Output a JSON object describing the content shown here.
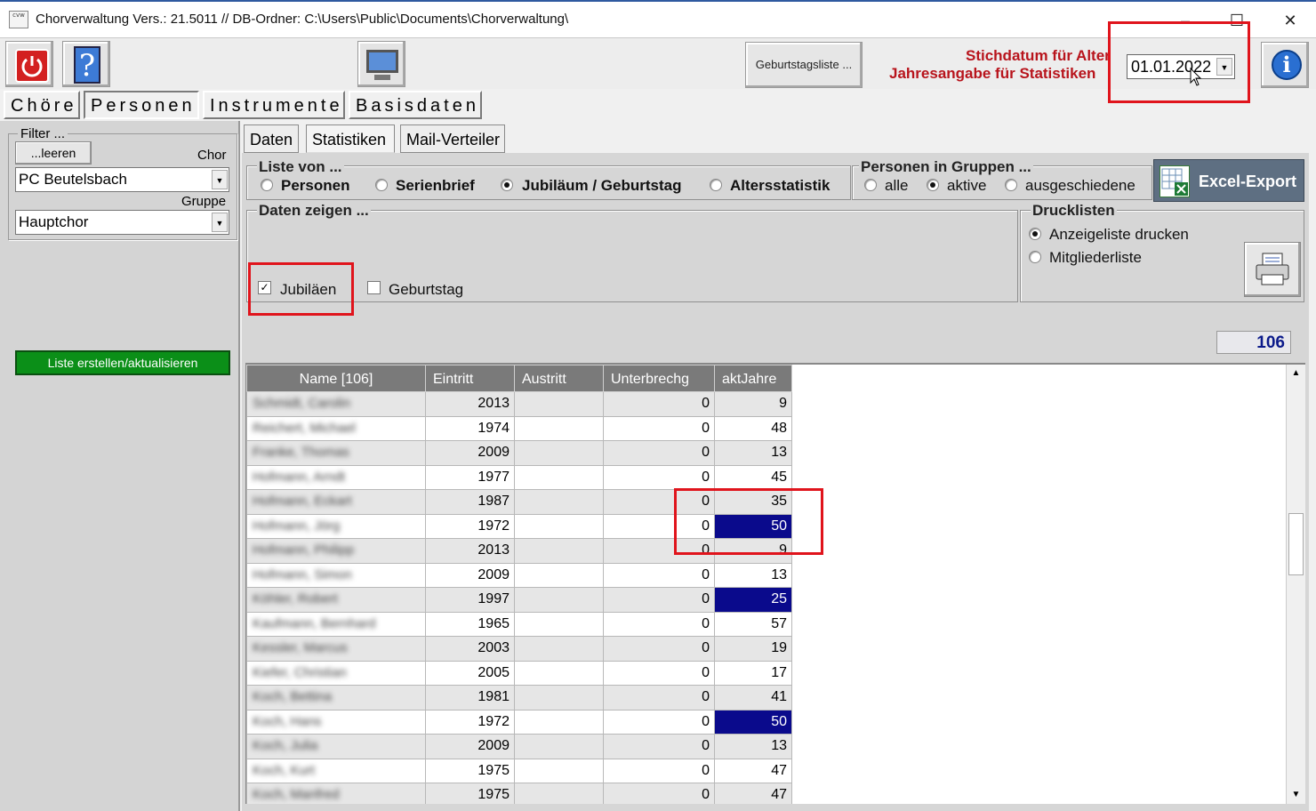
{
  "window": {
    "title": "Chorverwaltung Vers.: 21.5011 // DB-Ordner: C:\\Users\\Public\\Documents\\Chorverwaltung\\",
    "app_icon_text": "cvw",
    "minimize": "‒",
    "maximize": "☐",
    "close": "✕"
  },
  "toolbar": {
    "birthday_list_label": "Geburtstagsliste ...",
    "reference_label_1": "Stichdatum für Alter",
    "reference_label_2": "Jahresangabe für Statistiken",
    "reference_date": "01.01.2022",
    "help_glyph": "?",
    "info_glyph": "i"
  },
  "main_tabs": [
    {
      "label": "Chöre",
      "active": false
    },
    {
      "label": "Personen",
      "active": true
    },
    {
      "label": "Instrumente",
      "active": false
    },
    {
      "label": "Basisdaten",
      "active": false
    }
  ],
  "filter": {
    "group_label": "Filter ...",
    "clear_button": "...leeren",
    "choir_label": "Chor",
    "choir_value": "PC Beutelsbach",
    "group_field_label": "Gruppe",
    "group_value": "Hauptchor",
    "refresh_button": "Liste erstellen/aktualisieren"
  },
  "sub_tabs": [
    {
      "label": "Daten",
      "active": false
    },
    {
      "label": "Statistiken",
      "active": true
    },
    {
      "label": "Mail-Verteiler",
      "active": false
    }
  ],
  "list_of": {
    "title": "Liste von ...",
    "options": [
      {
        "label": "Personen",
        "selected": false
      },
      {
        "label": "Serienbrief",
        "selected": false
      },
      {
        "label": "Jubiläum / Geburtstag",
        "selected": true
      },
      {
        "label": "Altersstatistik",
        "selected": false
      }
    ]
  },
  "persons_in_groups": {
    "title": "Personen in Gruppen ...",
    "options": [
      {
        "label": "alle",
        "selected": false
      },
      {
        "label": "aktive",
        "selected": true
      },
      {
        "label": "ausgeschiedene",
        "selected": false
      }
    ]
  },
  "excel_export_label": "Excel-Export",
  "show_data": {
    "title": "Daten zeigen ...",
    "jubilees_label": "Jubiläen",
    "jubilees_checked": true,
    "birthday_label": "Geburtstag",
    "birthday_checked": false
  },
  "print_lists": {
    "title": "Drucklisten",
    "options": [
      {
        "label": "Anzeigeliste drucken",
        "selected": true
      },
      {
        "label": "Mitgliederliste",
        "selected": false
      }
    ]
  },
  "record_count": "106",
  "grid": {
    "columns": [
      "Name  [106]",
      "Eintritt",
      "Austritt",
      "Unterbrechg",
      "aktJahre"
    ],
    "rows": [
      {
        "name": "Schmidt, Carolin",
        "eintritt": "2013",
        "austritt": "",
        "unterbrechung": "0",
        "akt_jahre": "9",
        "highlight": false
      },
      {
        "name": "Reichert, Michael",
        "eintritt": "1974",
        "austritt": "",
        "unterbrechung": "0",
        "akt_jahre": "48",
        "highlight": false
      },
      {
        "name": "Franke, Thomas",
        "eintritt": "2009",
        "austritt": "",
        "unterbrechung": "0",
        "akt_jahre": "13",
        "highlight": false
      },
      {
        "name": "Hofmann, Arndt",
        "eintritt": "1977",
        "austritt": "",
        "unterbrechung": "0",
        "akt_jahre": "45",
        "highlight": false
      },
      {
        "name": "Hofmann, Eckart",
        "eintritt": "1987",
        "austritt": "",
        "unterbrechung": "0",
        "akt_jahre": "35",
        "highlight": false
      },
      {
        "name": "Hofmann, Jörg",
        "eintritt": "1972",
        "austritt": "",
        "unterbrechung": "0",
        "akt_jahre": "50",
        "highlight": true
      },
      {
        "name": "Hofmann, Philipp",
        "eintritt": "2013",
        "austritt": "",
        "unterbrechung": "0",
        "akt_jahre": "9",
        "highlight": false
      },
      {
        "name": "Hofmann, Simon",
        "eintritt": "2009",
        "austritt": "",
        "unterbrechung": "0",
        "akt_jahre": "13",
        "highlight": false
      },
      {
        "name": "Köhler, Robert",
        "eintritt": "1997",
        "austritt": "",
        "unterbrechung": "0",
        "akt_jahre": "25",
        "highlight": true
      },
      {
        "name": "Kaufmann, Bernhard",
        "eintritt": "1965",
        "austritt": "",
        "unterbrechung": "0",
        "akt_jahre": "57",
        "highlight": false
      },
      {
        "name": "Kessler, Marcus",
        "eintritt": "2003",
        "austritt": "",
        "unterbrechung": "0",
        "akt_jahre": "19",
        "highlight": false
      },
      {
        "name": "Kiefer, Christian",
        "eintritt": "2005",
        "austritt": "",
        "unterbrechung": "0",
        "akt_jahre": "17",
        "highlight": false
      },
      {
        "name": "Koch, Bettina",
        "eintritt": "1981",
        "austritt": "",
        "unterbrechung": "0",
        "akt_jahre": "41",
        "highlight": false
      },
      {
        "name": "Koch, Hans",
        "eintritt": "1972",
        "austritt": "",
        "unterbrechung": "0",
        "akt_jahre": "50",
        "highlight": true
      },
      {
        "name": "Koch, Julia",
        "eintritt": "2009",
        "austritt": "",
        "unterbrechung": "0",
        "akt_jahre": "13",
        "highlight": false
      },
      {
        "name": "Koch, Kurt",
        "eintritt": "1975",
        "austritt": "",
        "unterbrechung": "0",
        "akt_jahre": "47",
        "highlight": false
      },
      {
        "name": "Koch, Manfred",
        "eintritt": "1975",
        "austritt": "",
        "unterbrechung": "0",
        "akt_jahre": "47",
        "highlight": false
      }
    ]
  },
  "scroll": {
    "up": "▲",
    "down": "▼"
  },
  "colors": {
    "accent_red": "#b8141c",
    "highlight_blue": "#0a0a8c",
    "refresh_green": "#0b8f18",
    "annotation_red": "#e0141c"
  }
}
